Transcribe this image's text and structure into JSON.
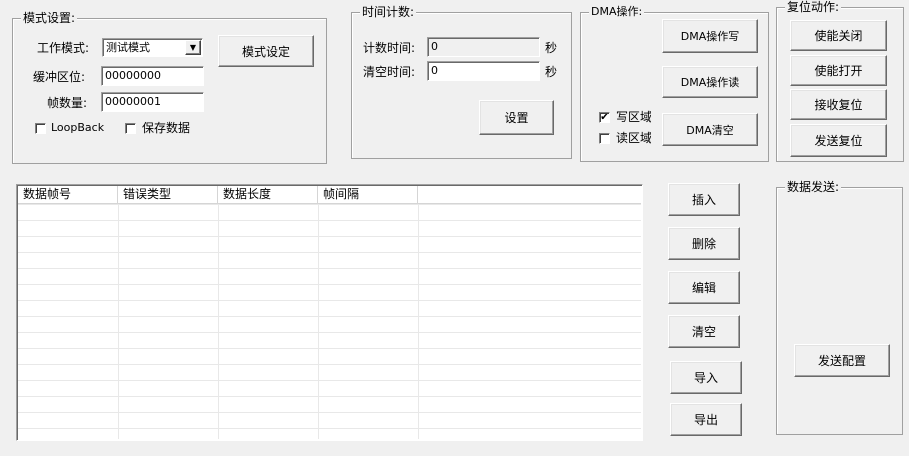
{
  "mode_group": {
    "title": "模式设置:",
    "work_mode_label": "工作模式:",
    "work_mode_value": "测试模式",
    "mode_set_button": "模式设定",
    "buffer_label": "缓冲区位:",
    "buffer_value": "00000000",
    "frame_count_label": "帧数量:",
    "frame_count_value": "00000001",
    "loopback_label": "LoopBack",
    "loopback_checked": false,
    "save_data_label": "保存数据",
    "save_data_checked": false
  },
  "timer_group": {
    "title": "时间计数:",
    "count_time_label": "计数时间:",
    "count_time_value": "0",
    "count_time_unit": "秒",
    "clear_time_label": "清空时间:",
    "clear_time_value": "0",
    "clear_time_unit": "秒",
    "set_button": "设置"
  },
  "dma_group": {
    "title": "DMA操作:",
    "write_button": "DMA操作写",
    "read_button": "DMA操作读",
    "clear_button": "DMA清空",
    "write_area_label": "写区域",
    "write_area_checked": true,
    "read_area_label": "读区域",
    "read_area_checked": false
  },
  "reset_group": {
    "title": "复位动作:",
    "disable_button": "使能关闭",
    "enable_button": "使能打开",
    "rx_reset_button": "接收复位",
    "tx_reset_button": "发送复位"
  },
  "list": {
    "columns": [
      "数据帧号",
      "错误类型",
      "数据长度",
      "帧间隔"
    ]
  },
  "list_actions": {
    "insert": "插入",
    "delete": "删除",
    "edit": "编辑",
    "clear": "清空",
    "import": "导入",
    "export": "导出"
  },
  "send_group": {
    "title": "数据发送:",
    "config_button": "发送配置"
  }
}
